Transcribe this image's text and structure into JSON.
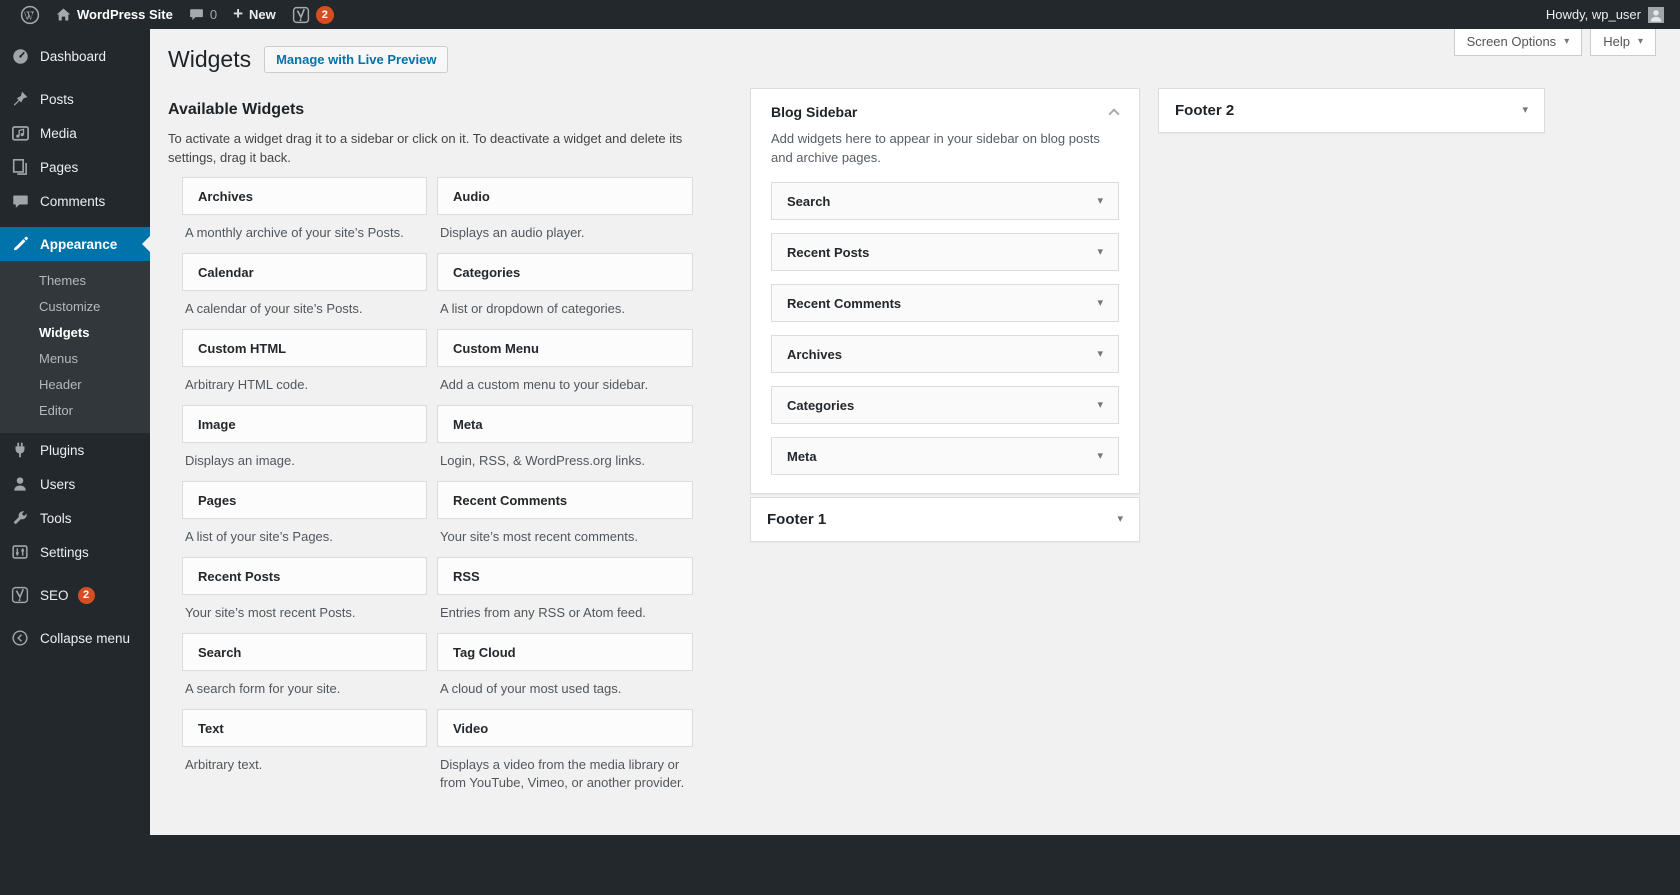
{
  "colors": {
    "accent": "#0073aa",
    "admin_dark": "#23282d",
    "badge": "#d54e21",
    "content_bg": "#f1f1f1"
  },
  "icons": {
    "chevron_down": "▾",
    "plus": "+"
  },
  "admin_bar": {
    "site_name": "WordPress Site",
    "comments_count": "0",
    "new_label": "New",
    "seo_badge": "2",
    "howdy": "Howdy, wp_user"
  },
  "sidebar": {
    "items": [
      {
        "label": "Dashboard"
      },
      {
        "label": "Posts"
      },
      {
        "label": "Media"
      },
      {
        "label": "Pages"
      },
      {
        "label": "Comments"
      },
      {
        "label": "Appearance"
      },
      {
        "label": "Plugins"
      },
      {
        "label": "Users"
      },
      {
        "label": "Tools"
      },
      {
        "label": "Settings"
      },
      {
        "label": "SEO",
        "badge": "2"
      },
      {
        "label": "Collapse menu"
      }
    ],
    "appearance_submenu": [
      "Themes",
      "Customize",
      "Widgets",
      "Menus",
      "Header",
      "Editor"
    ]
  },
  "header": {
    "title": "Widgets",
    "manage_button": "Manage with Live Preview",
    "screen_options": "Screen Options",
    "help": "Help"
  },
  "available_widgets": {
    "title": "Available Widgets",
    "description": "To activate a widget drag it to a sidebar or click on it. To deactivate a widget and delete its settings, drag it back.",
    "widgets": [
      {
        "name": "Archives",
        "description": "A monthly archive of your site’s Posts."
      },
      {
        "name": "Audio",
        "description": "Displays an audio player."
      },
      {
        "name": "Calendar",
        "description": "A calendar of your site’s Posts."
      },
      {
        "name": "Categories",
        "description": "A list or dropdown of categories."
      },
      {
        "name": "Custom HTML",
        "description": "Arbitrary HTML code."
      },
      {
        "name": "Custom Menu",
        "description": "Add a custom menu to your sidebar."
      },
      {
        "name": "Image",
        "description": "Displays an image."
      },
      {
        "name": "Meta",
        "description": "Login, RSS, & WordPress.org links."
      },
      {
        "name": "Pages",
        "description": "A list of your site’s Pages."
      },
      {
        "name": "Recent Comments",
        "description": "Your site’s most recent comments."
      },
      {
        "name": "Recent Posts",
        "description": "Your site’s most recent Posts."
      },
      {
        "name": "RSS",
        "description": "Entries from any RSS or Atom feed."
      },
      {
        "name": "Search",
        "description": "A search form for your site."
      },
      {
        "name": "Tag Cloud",
        "description": "A cloud of your most used tags."
      },
      {
        "name": "Text",
        "description": "Arbitrary text."
      },
      {
        "name": "Video",
        "description": "Displays a video from the media library or from YouTube, Vimeo, or another provider."
      }
    ]
  },
  "sidebars": {
    "blog": {
      "title": "Blog Sidebar",
      "description": "Add widgets here to appear in your sidebar on blog posts and archive pages.",
      "widgets": [
        "Search",
        "Recent Posts",
        "Recent Comments",
        "Archives",
        "Categories",
        "Meta"
      ]
    },
    "footer1": {
      "title": "Footer 1"
    },
    "footer2": {
      "title": "Footer 2"
    }
  }
}
